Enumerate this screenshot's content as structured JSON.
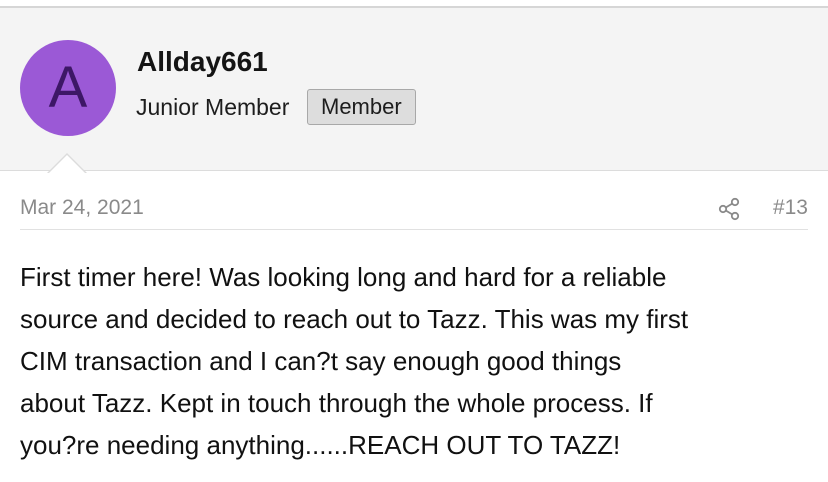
{
  "user": {
    "avatar_letter": "A",
    "username": "Allday661",
    "title": "Junior Member",
    "badge": "Member"
  },
  "post": {
    "date": "Mar 24, 2021",
    "share_icon": "share-icon",
    "number": "#13",
    "body_lines": [
      "First timer here! Was looking long and hard for a reliable",
      "source and decided to reach out to Tazz. This was my first",
      "CIM transaction and I can?t say enough good things",
      "about Tazz. Kept in touch through the whole process. If",
      "you?re needing anything......REACH OUT TO TAZZ!"
    ]
  },
  "colors": {
    "avatar_bg": "#9b59d6",
    "avatar_letter": "#3d1766",
    "header_bg": "#f4f4f4",
    "meta_text": "#8a8a8a"
  }
}
